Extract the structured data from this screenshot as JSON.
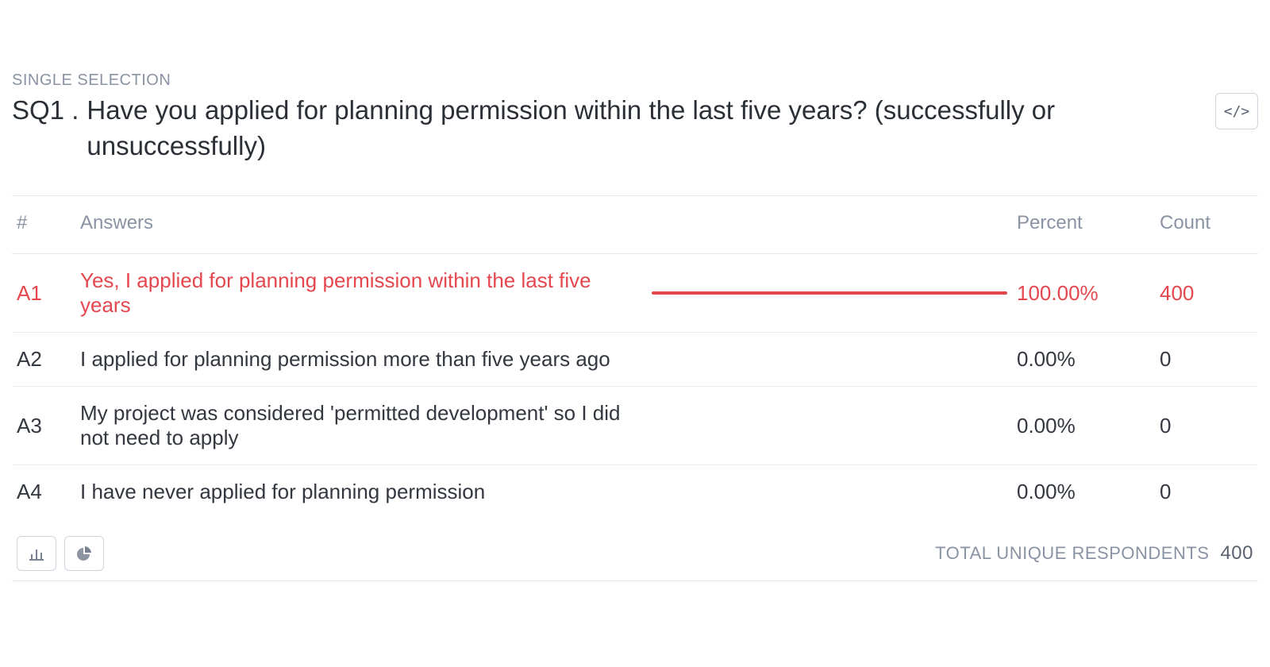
{
  "question": {
    "type_label": "SINGLE SELECTION",
    "code": "SQ1 .",
    "text": "Have you applied for planning permission within the last five years? (successfully or unsuccessfully)"
  },
  "columns": {
    "id": "#",
    "answers": "Answers",
    "percent": "Percent",
    "count": "Count"
  },
  "rows": [
    {
      "id": "A1",
      "answer": "Yes, I applied for planning permission within the last five years",
      "percent": "100.00%",
      "count": "400",
      "bar_pct": 100,
      "highlight": true
    },
    {
      "id": "A2",
      "answer": "I applied for planning permission more than five years ago",
      "percent": "0.00%",
      "count": "0",
      "bar_pct": 0,
      "highlight": false
    },
    {
      "id": "A3",
      "answer": "My project was considered 'permitted development' so I did not need to apply",
      "percent": "0.00%",
      "count": "0",
      "bar_pct": 0,
      "highlight": false
    },
    {
      "id": "A4",
      "answer": "I have never applied for planning permission",
      "percent": "0.00%",
      "count": "0",
      "bar_pct": 0,
      "highlight": false
    }
  ],
  "footer": {
    "label": "TOTAL UNIQUE RESPONDENTS",
    "value": "400"
  },
  "icons": {
    "embed": "</>"
  },
  "chart_data": {
    "type": "bar",
    "title": "SQ1. Have you applied for planning permission within the last five years? (successfully or unsuccessfully)",
    "orientation": "horizontal",
    "categories": [
      "A1",
      "A2",
      "A3",
      "A4"
    ],
    "category_labels": [
      "Yes, I applied for planning permission within the last five years",
      "I applied for planning permission more than five years ago",
      "My project was considered 'permitted development' so I did not need to apply",
      "I have never applied for planning permission"
    ],
    "series": [
      {
        "name": "Percent",
        "values": [
          100.0,
          0.0,
          0.0,
          0.0
        ]
      },
      {
        "name": "Count",
        "values": [
          400,
          0,
          0,
          0
        ]
      }
    ],
    "xlabel": "Percent",
    "ylabel": "Answers",
    "xlim": [
      0,
      100
    ],
    "total_unique_respondents": 400
  }
}
